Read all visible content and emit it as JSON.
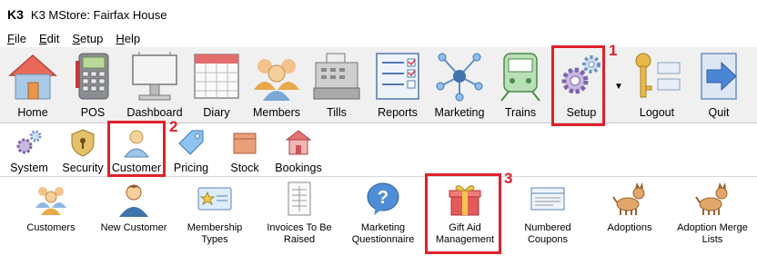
{
  "window": {
    "app_logo": "K3",
    "title": "K3 MStore: Fairfax House"
  },
  "menu": [
    {
      "accel": "F",
      "rest": "ile"
    },
    {
      "accel": "E",
      "rest": "dit"
    },
    {
      "accel": "S",
      "rest": "etup"
    },
    {
      "accel": "H",
      "rest": "elp"
    }
  ],
  "toolbar": {
    "items": [
      {
        "label": "Home",
        "icon": "house-icon"
      },
      {
        "label": "POS",
        "icon": "pos-terminal-icon"
      },
      {
        "label": "Dashboard",
        "icon": "billboard-icon"
      },
      {
        "label": "Diary",
        "icon": "calendar-icon"
      },
      {
        "label": "Members",
        "icon": "people-group-icon"
      },
      {
        "label": "Tills",
        "icon": "cash-register-icon"
      },
      {
        "label": "Reports",
        "icon": "checklist-report-icon"
      },
      {
        "label": "Marketing",
        "icon": "network-icon"
      },
      {
        "label": "Trains",
        "icon": "train-icon"
      },
      {
        "label": "Setup",
        "icon": "gears-icon"
      },
      {
        "label": "Logout",
        "icon": "key-icon"
      },
      {
        "label": "Quit",
        "icon": "exit-arrow-icon"
      }
    ],
    "dropdown_icon": "dropdown-triangle-icon"
  },
  "subbar": {
    "items": [
      {
        "label": "System",
        "icon": "gears-icon"
      },
      {
        "label": "Security",
        "icon": "shield-lock-icon"
      },
      {
        "label": "Customer",
        "icon": "person-icon"
      },
      {
        "label": "Pricing",
        "icon": "price-tag-icon"
      },
      {
        "label": "Stock",
        "icon": "box-icon"
      },
      {
        "label": "Bookings",
        "icon": "building-icon"
      }
    ]
  },
  "content": {
    "items": [
      {
        "label": "Customers",
        "icon": "people-group-icon"
      },
      {
        "label": "New Customer",
        "icon": "person-add-icon"
      },
      {
        "label": "Membership\nTypes",
        "icon": "membership-card-icon"
      },
      {
        "label": "Invoices To Be\nRaised",
        "icon": "invoice-icon"
      },
      {
        "label": "Marketing\nQuestionnaire",
        "icon": "question-bubble-icon"
      },
      {
        "label": "Gift Aid\nManagement",
        "icon": "gift-icon"
      },
      {
        "label": "Numbered\nCoupons",
        "icon": "coupon-icon"
      },
      {
        "label": "Adoptions",
        "icon": "dog-icon"
      },
      {
        "label": "Adoption Merge\nLists",
        "icon": "dog-icon"
      }
    ]
  },
  "annotations": {
    "step1": "1",
    "step2": "2",
    "step3": "3",
    "color": "#e0202b"
  }
}
